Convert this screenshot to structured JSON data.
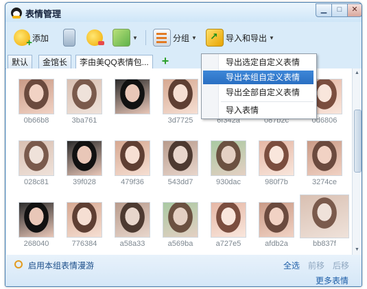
{
  "window": {
    "title": "表情管理"
  },
  "toolbar": {
    "add_label": "添加",
    "group_label": "分组",
    "import_export_label": "导入和导出"
  },
  "tabs": [
    {
      "label": "默认"
    },
    {
      "label": "金馆长"
    },
    {
      "label": "李由美QQ表情包..."
    }
  ],
  "thumbnails": [
    {
      "name": "0b66b8"
    },
    {
      "name": "3ba761"
    },
    {
      "name": ""
    },
    {
      "name": "3d7725"
    },
    {
      "name": "6f342a"
    },
    {
      "name": "087b2c"
    },
    {
      "name": "0d6806"
    },
    {
      "name": "028c81"
    },
    {
      "name": "39f028"
    },
    {
      "name": "479f36"
    },
    {
      "name": "543dd7"
    },
    {
      "name": "930dac"
    },
    {
      "name": "980f7b"
    },
    {
      "name": "3274ce"
    },
    {
      "name": "268040"
    },
    {
      "name": "776384"
    },
    {
      "name": "a58a33"
    },
    {
      "name": "a569ba"
    },
    {
      "name": "a727e5"
    },
    {
      "name": "afdb2a"
    },
    {
      "name": "bb837f"
    }
  ],
  "context_menu": {
    "items": [
      {
        "label": "导出选定自定义表情"
      },
      {
        "label": "导出本组自定义表情"
      },
      {
        "label": "导出全部自定义表情"
      },
      {
        "label": "导入表情"
      }
    ]
  },
  "footer": {
    "roam_label": "启用本组表情漫游",
    "select_all": "全选",
    "move_forward": "前移",
    "move_back": "后移",
    "more_label": "更多表情"
  },
  "colors": {
    "accent": "#2a6fc2",
    "link": "#1f5fa8",
    "disabled_link": "#8fa7c0",
    "window_bg": "#d9ebf9"
  }
}
